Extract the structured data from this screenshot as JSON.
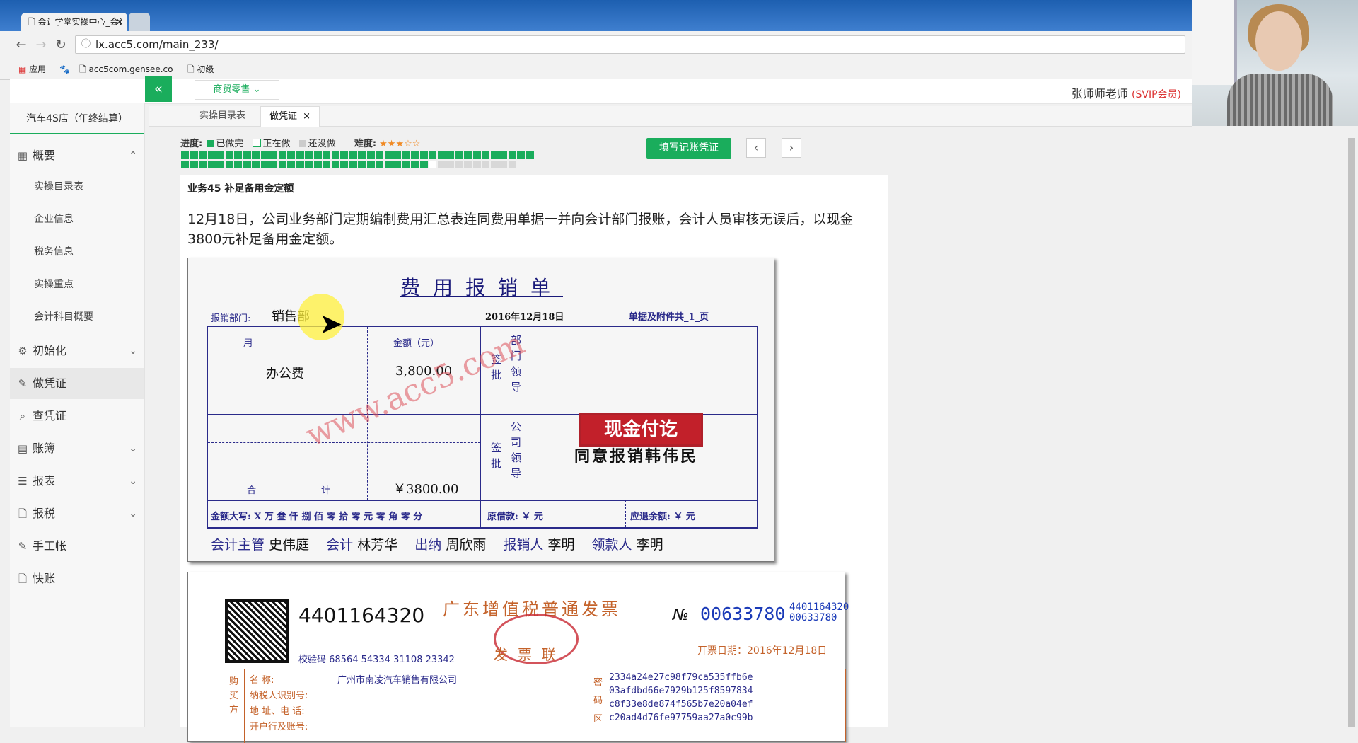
{
  "browser": {
    "tabs": [
      {
        "title": "会计学堂实操中心_会计"
      },
      {
        "title": ""
      }
    ],
    "url": "lx.acc5.com/main_233/",
    "bookmarks": [
      "应用",
      "acc5com.gensee.co",
      "初级"
    ]
  },
  "header": {
    "module": "商贸零售",
    "user": "张师师老师",
    "user_badge": "(SVIP会员)"
  },
  "sidebar": {
    "company": "汽车4S店（年终结算）",
    "items": [
      {
        "label": "概要",
        "icon": "grid-icon",
        "expanded": true
      },
      {
        "label": "初始化",
        "icon": "gear-icon"
      },
      {
        "label": "做凭证",
        "icon": "pen-icon",
        "active": true
      },
      {
        "label": "查凭证",
        "icon": "search-icon"
      },
      {
        "label": "账簿",
        "icon": "book-icon"
      },
      {
        "label": "报表",
        "icon": "report-icon"
      },
      {
        "label": "报税",
        "icon": "document-icon"
      },
      {
        "label": "手工帐",
        "icon": "pen-icon"
      },
      {
        "label": "快账",
        "icon": "document-icon"
      }
    ],
    "sub_items": [
      "实操目录表",
      "企业信息",
      "税务信息",
      "实操重点",
      "会计科目概要"
    ]
  },
  "content_tabs": [
    {
      "label": "实操目录表"
    },
    {
      "label": "做凭证",
      "close": "×"
    }
  ],
  "progress": {
    "label": "进度:",
    "done": "已做完",
    "doing": "正在做",
    "todo": "还没做",
    "difficulty_label": "难度:",
    "difficulty_stars": "★★★☆☆",
    "done_count": 68,
    "current": 69,
    "total": 78,
    "colors": {
      "done": "#1aad5c",
      "doing": "#ffffff",
      "todo": "#d8d8d8"
    }
  },
  "actions": {
    "fill_voucher": "填写记账凭证",
    "prev": "‹",
    "next": "›"
  },
  "task": {
    "title": "业务45 补足备用金定额",
    "description": "12月18日，公司业务部门定期编制费用汇总表连同费用单据一并向会计部门报账，会计人员审核无误后，以现金3800元补足备用金定额。"
  },
  "expense_form": {
    "title": "费用报销单",
    "dept_label": "报销部门:",
    "dept_value": "销售部",
    "date": "2016年12月18日",
    "attachments": "单据及附件共_1_页",
    "col_purpose": "用",
    "col_amount": "金额（元）",
    "row1_purpose": "办公费",
    "row1_amount": "3,800.00",
    "total_label_1": "合",
    "total_label_2": "计",
    "total_amount": "￥3800.00",
    "sign1_left": "签批",
    "sign1_right": "部门领导",
    "sign2_left": "签批",
    "sign2_right": "公司领导",
    "stamp": "现金付讫",
    "approval": "同意报销韩伟民",
    "amount_words": "金额大写: X 万 叁 仟 捌 佰 零 拾 零 元 零 角 零 分",
    "loan": "原借款: ￥      元",
    "refund": "应退余额: ￥      元",
    "footer": [
      {
        "label": "会计主管",
        "name": "史伟庭"
      },
      {
        "label": "会计",
        "name": "林芳华"
      },
      {
        "label": "出纳",
        "name": "周欣雨"
      },
      {
        "label": "报销人",
        "name": "李明"
      },
      {
        "label": "领款人",
        "name": "李明"
      }
    ],
    "watermark": "www.acc5.com"
  },
  "invoice": {
    "code": "4401164320",
    "check_code": "校验码 68564 54334 31108 23342",
    "title": "广东增值税普通发票",
    "sub_label": "发票联",
    "no_label": "№",
    "number": "00633780",
    "code_small_1": "4401164320",
    "code_small_2": "00633780",
    "date": "开票日期：2016年12月18日",
    "buyer_label": "购买方",
    "fields": [
      {
        "label": "名          称:",
        "value": "广州市南凌汽车销售有限公司"
      },
      {
        "label": "纳税人识别号:",
        "value": ""
      },
      {
        "label": "地 址、电 话:",
        "value": ""
      },
      {
        "label": "开户行及账号:",
        "value": ""
      }
    ],
    "cipher_label": "密码区",
    "cipher_lines": [
      "2334a24e27c98f79ca535ffb6e",
      "03afdbd66e7929b125f8597834",
      "c8f33e8de874f565b7e20a04ef",
      "c20ad4d76fe97759aa27a0c99b"
    ]
  }
}
